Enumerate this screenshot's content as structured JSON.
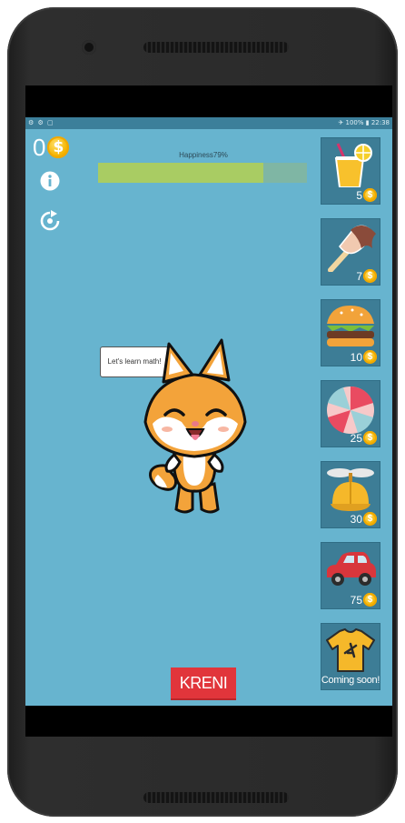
{
  "status_bar": {
    "left_icons": "⚙ ⚙ ▢",
    "right": "✈ 100% ▮ 22:38"
  },
  "coins": {
    "count": "0",
    "symbol": "$"
  },
  "toolbar": {
    "info_icon": "info-icon",
    "refresh_icon": "refresh-icon"
  },
  "happiness": {
    "label": "Happiness79%",
    "value": 0.79,
    "fill_color": "#a9cc63"
  },
  "speech_bubble": {
    "text": "Let's learn math!"
  },
  "shop": {
    "items": [
      {
        "name": "juice",
        "price": "5"
      },
      {
        "name": "ice-cream",
        "price": "7"
      },
      {
        "name": "burger",
        "price": "10"
      },
      {
        "name": "beach-ball",
        "price": "25"
      },
      {
        "name": "propeller-cap",
        "price": "30"
      },
      {
        "name": "car",
        "price": "75"
      },
      {
        "name": "t-shirt",
        "label": "Coming soon!"
      }
    ],
    "coin_symbol": "$"
  },
  "start_button": {
    "label": "KRENI"
  },
  "colors": {
    "background": "#67b4cf",
    "button": "#e1353b",
    "tile": "#3d7d96"
  }
}
